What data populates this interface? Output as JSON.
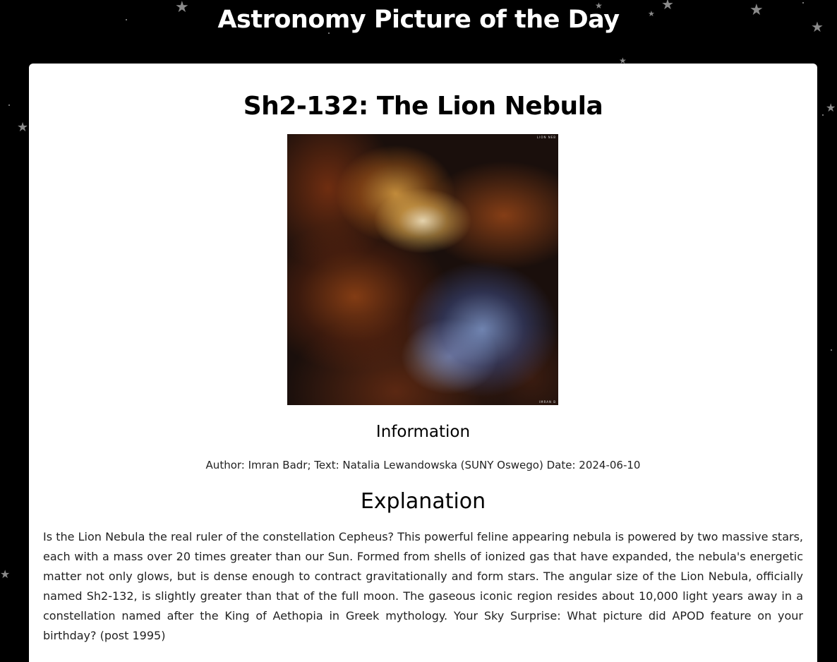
{
  "site": {
    "title": "Astronomy Picture of the Day"
  },
  "apod": {
    "title": "Sh2-132: The Lion Nebula",
    "image": {
      "alt": "Sh2-132: The Lion Nebula",
      "caption_top": "LION NEB",
      "caption_bottom": "IMRAN B"
    },
    "info_heading": "Information",
    "info_line": "Author: Imran Badr; Text: Natalia Lewandowska (SUNY Oswego) Date: 2024-06-10",
    "explanation_heading": "Explanation",
    "explanation": "Is the Lion Nebula the real ruler of the constellation Cepheus? This powerful feline appearing nebula is powered by two massive stars, each with a mass over 20 times greater than our Sun. Formed from shells of ionized gas that have expanded, the nebula's energetic matter not only glows, but is dense enough to contract gravitationally and form stars. The angular size of the Lion Nebula, officially named Sh2-132, is slightly greater than that of the full moon. The gaseous iconic region resides about 10,000 light years away in a constellation named after the King of Aethopia in Greek mythology. Your Sky Surprise: What picture did APOD feature on your birthday? (post 1995)"
  },
  "background": {
    "star_icon": "star-icon",
    "star_color": "#8a8a8a",
    "background_color": "#000000",
    "card_color": "#ffffff"
  }
}
